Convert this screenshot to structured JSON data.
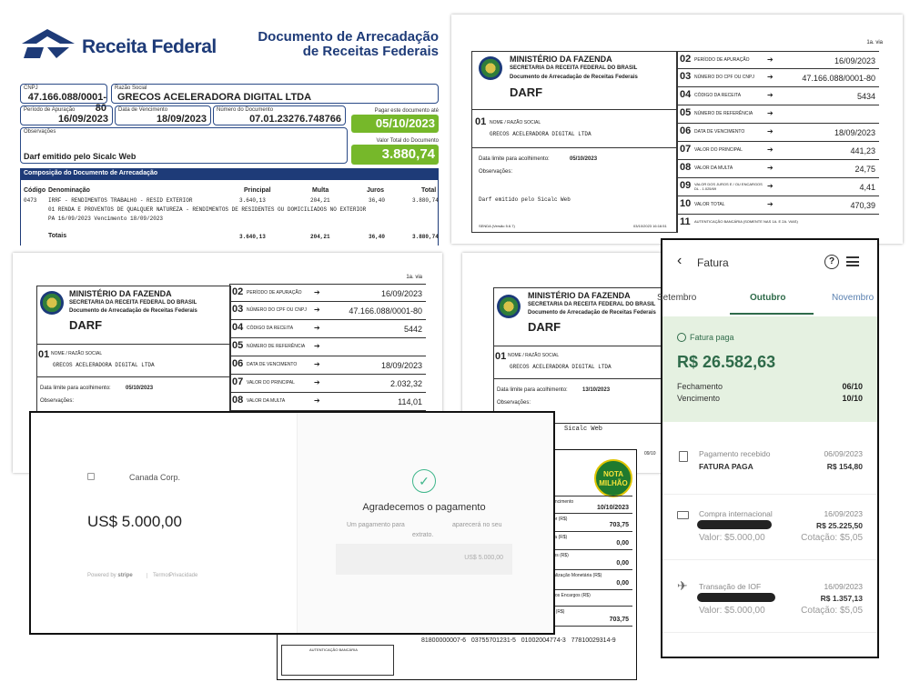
{
  "receita": {
    "brand": "Receita Federal",
    "doc_title_1": "Documento de Arrecadação",
    "doc_title_2": "de Receitas Federais",
    "cnpj_label": "CNPJ",
    "cnpj": "47.166.088/0001-80",
    "razao_label": "Razão Social",
    "razao": "GRECOS ACELERADORA DIGITAL LTDA",
    "periodo_label": "Período de Apuração",
    "periodo": "16/09/2023",
    "venc_label": "Data de Vencimento",
    "venc": "18/09/2023",
    "numdoc_label": "Número do Documento",
    "numdoc": "07.01.23276.748766",
    "pagar_label": "Pagar este documento até",
    "pagar": "05/10/2023",
    "obs_label": "Observações",
    "obs": "Darf emitido pelo Sicalc Web",
    "total_label": "Valor Total do Documento",
    "total": "3.880,74",
    "comp_header": "Composição do Documento de Arrecadação",
    "cols": [
      "Código",
      "Denominação",
      "Principal",
      "Multa",
      "Juros",
      "Total"
    ],
    "row_code": "0473",
    "row_desc1": "IRRF - RENDIMENTOS TRABALHO - RESID EXTERIOR",
    "row_desc2": "01 RENDA E PROVENTOS DE QUALQUER NATUREZA - RENDIMENTOS DE RESIDENTES OU DOMICILIADOS NO EXTERIOR",
    "row_desc3": "PA 16/09/2023 Vencimento 18/09/2023",
    "row_vals": [
      "3.640,13",
      "204,21",
      "36,40",
      "3.880,74"
    ],
    "totals_label": "Totais",
    "totals_vals": [
      "3.640,13",
      "204,21",
      "36,40",
      "3.880,74"
    ]
  },
  "darf_a": {
    "via": "1a. via",
    "ministry": "MINISTÉRIO DA FAZENDA",
    "secretaria": "SECRETARIA DA RECEITA FEDERAL DO BRASIL",
    "doc": "Documento de Arrecadação de Receitas Federais",
    "darf": "DARF",
    "nome_label": "NOME / RAZÃO SOCIAL",
    "nome": "GRECOS ACELERADORA DIGITAL LTDA",
    "limite_label": "Data limite para acolhimento:",
    "limite": "05/10/2023",
    "obs_label": "Observações:",
    "obs": "Darf emitido pelo Sicalc Web",
    "senda": "SENDA (Versão 5.6.7)",
    "printed": "03/10/2023 16:16:51",
    "rows": [
      {
        "n": "02",
        "label": "PERÍODO DE APURAÇÃO",
        "value": "16/09/2023"
      },
      {
        "n": "03",
        "label": "NÚMERO DO CPF OU CNPJ",
        "value": "47.166.088/0001-80"
      },
      {
        "n": "04",
        "label": "CÓDIGO DA RECEITA",
        "value": "5434"
      },
      {
        "n": "05",
        "label": "NÚMERO DE REFERÊNCIA",
        "value": ""
      },
      {
        "n": "06",
        "label": "DATA DE VENCIMENTO",
        "value": "18/09/2023"
      },
      {
        "n": "07",
        "label": "VALOR DO PRINCIPAL",
        "value": "441,23"
      },
      {
        "n": "08",
        "label": "VALOR DA MULTA",
        "value": "24,75"
      },
      {
        "n": "09",
        "label": "VALOR DOS JUROS E / OU ENCARGOS DL - 1.025/69",
        "value": "4,41"
      },
      {
        "n": "10",
        "label": "VALOR TOTAL",
        "value": "470,39"
      },
      {
        "n": "11",
        "label": "AUTENTICAÇÃO BANCÁRIA (Somente nas 1a. e 2a. vias)",
        "value": ""
      }
    ]
  },
  "darf_b": {
    "via": "1a. via",
    "ministry": "MINISTÉRIO DA FAZENDA",
    "secretaria": "SECRETARIA DA RECEITA FEDERAL DO BRASIL",
    "doc": "Documento de Arrecadação de Receitas Federais",
    "darf": "DARF",
    "nome_label": "NOME / RAZÃO SOCIAL",
    "nome": "GRECOS ACELERADORA DIGITAL LTDA",
    "limite_label": "Data limite para acolhimento:",
    "limite": "05/10/2023",
    "obs_label": "Observações:",
    "rows": [
      {
        "n": "02",
        "label": "PERÍODO DE APURAÇÃO",
        "value": "16/09/2023"
      },
      {
        "n": "03",
        "label": "NÚMERO DO CPF OU CNPJ",
        "value": "47.166.088/0001-80"
      },
      {
        "n": "04",
        "label": "CÓDIGO DA RECEITA",
        "value": "5442"
      },
      {
        "n": "05",
        "label": "NÚMERO DE REFERÊNCIA",
        "value": ""
      },
      {
        "n": "06",
        "label": "DATA DE VENCIMENTO",
        "value": "18/09/2023"
      },
      {
        "n": "07",
        "label": "VALOR DO PRINCIPAL",
        "value": "2.032,32"
      },
      {
        "n": "08",
        "label": "VALOR DA MULTA",
        "value": "114,01"
      }
    ]
  },
  "darf_c": {
    "ministry": "MINISTÉRIO DA FAZENDA",
    "secretaria": "SECRETARIA DA RECEITA FEDERAL DO BRASIL",
    "doc": "Documento de Arrecadação de Receitas Federais",
    "darf": "DARF",
    "nome_label": "NOME / RAZÃO SOCIAL",
    "nome": "GRECOS ACELERADORA DIGITAL LTDA",
    "limite_label": "Data limite para acolhimento:",
    "limite": "13/10/2023",
    "obs_label": "Observações:",
    "obs_partial": "Sicalc Web",
    "printed_partial": "09/10",
    "nota_badge": "NOTA MILHÃO",
    "rows": [
      {
        "label": "Vencimento",
        "value": "10/10/2023"
      },
      {
        "label": "alor (R$)",
        "value": "703,75"
      },
      {
        "label": "ulta (R$)",
        "value": "0,00"
      },
      {
        "label": "uros (R$)",
        "value": "0,00"
      },
      {
        "label": "tualização Monetária (R$)",
        "value": "0,00"
      },
      {
        "label": "utros Encargos (R$)",
        "value": ""
      },
      {
        "label": "tal (R$)",
        "value": "703,75"
      }
    ],
    "barcode": "81800000007-6   03755701231-5   01002004774-3   77810029314-9",
    "auth_label": "AUTENTICAÇÃO BANCÁRIA"
  },
  "stripe": {
    "merchant": "Canada Corp.",
    "amount": "US$ 5.000,00",
    "powered": "Powered by",
    "brand": "stripe",
    "terms": "Termos",
    "privacy": "Privacidade",
    "thanks": "Agradecemos o pagamento",
    "desc_a": "Um pagamento para",
    "desc_b": "aparecerá no seu",
    "desc_c": "extrato.",
    "receipt_amount": "US$ 5.000,00"
  },
  "fatura": {
    "title": "Fatura",
    "months": [
      "Setembro",
      "Outubro",
      "Novembro"
    ],
    "status": "Fatura paga",
    "amount": "R$ 26.582,63",
    "fech_label": "Fechamento",
    "fech": "06/10",
    "venc_label": "Vencimento",
    "venc": "10/10",
    "accent": "#2f6b4a",
    "tx": [
      {
        "title": "Pagamento recebido",
        "sub": "FATURA PAGA",
        "date": "06/09/2023",
        "amount": "R$ 154,80",
        "extra1": "",
        "extra2": ""
      },
      {
        "title": "Compra internacional",
        "sub": "",
        "date": "16/09/2023",
        "amount": "R$ 25.225,50",
        "extra1": "Valor: $5.000,00",
        "extra2": "Cotação: $5,05"
      },
      {
        "title": "Transação de IOF",
        "sub": "",
        "date": "16/09/2023",
        "amount": "R$ 1.357,13",
        "extra1": "Valor: $5.000,00",
        "extra2": "Cotação: $5,05"
      }
    ]
  }
}
